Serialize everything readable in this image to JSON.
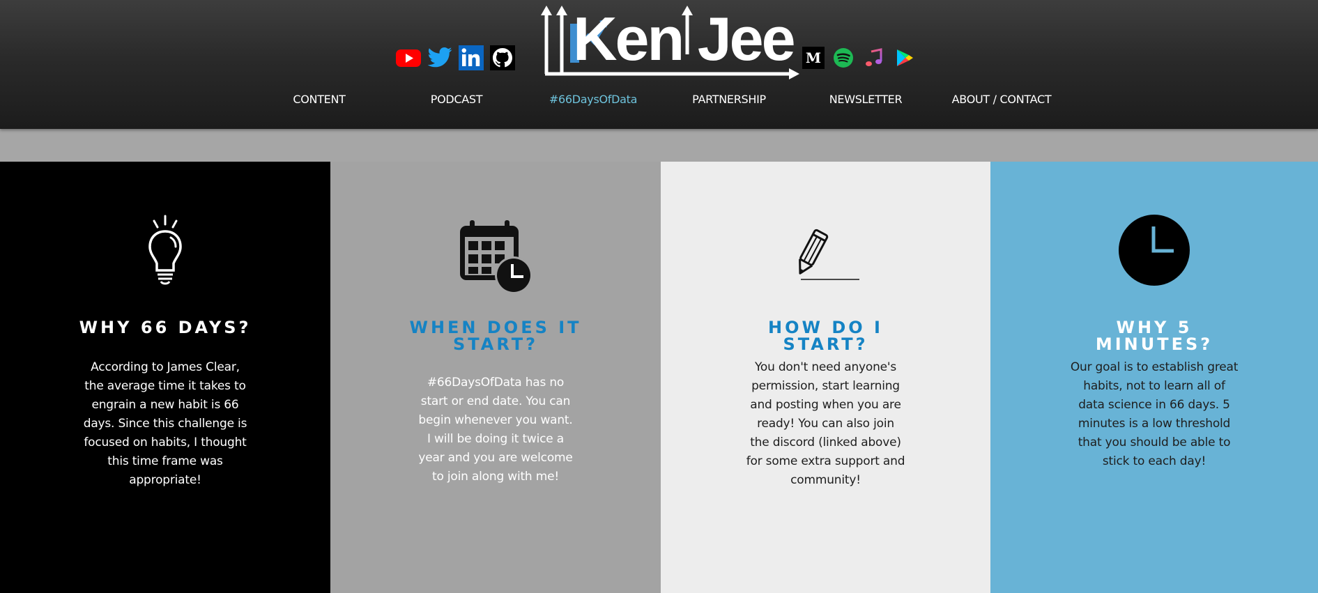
{
  "header": {
    "logo_text": "Ken Jee",
    "social_left": [
      {
        "name": "youtube-icon",
        "color": "#ff0000"
      },
      {
        "name": "twitter-icon",
        "color": "#1da1f2"
      },
      {
        "name": "linkedin-icon",
        "color": "#0a66c2"
      },
      {
        "name": "github-icon",
        "color": "#ffffff"
      }
    ],
    "social_right": [
      {
        "name": "medium-icon",
        "color": "#000000"
      },
      {
        "name": "spotify-icon",
        "color": "#1db954"
      },
      {
        "name": "apple-music-icon",
        "color": "#fc3c44"
      },
      {
        "name": "google-play-icon",
        "color": "#34a853"
      }
    ],
    "nav": [
      {
        "label": "CONTENT",
        "active": false
      },
      {
        "label": "PODCAST",
        "active": false
      },
      {
        "label": "#66DaysOfData",
        "active": true
      },
      {
        "label": "PARTNERSHIP",
        "active": false
      },
      {
        "label": "NEWSLETTER",
        "active": false
      },
      {
        "label": "ABOUT / CONTACT",
        "active": false
      }
    ],
    "active_color": "#6ec3dc"
  },
  "columns": [
    {
      "icon": "lightbulb-icon",
      "title": "WHY 66 DAYS?",
      "body": "According to James Clear, the average time it takes to engrain a new habit is 66 days. Since this challenge is focused on habits, I thought this time frame was appropriate!",
      "background": "#000000"
    },
    {
      "icon": "calendar-clock-icon",
      "title": "WHEN DOES IT START?",
      "body": "#66DaysOfData has no start or end date. You can begin whenever you want. I will be doing it twice a year and you are welcome to join along with me!",
      "background": "#a3a3a3"
    },
    {
      "icon": "pencil-icon",
      "title": "HOW DO I START?",
      "body": "You don't need anyone's permission, start learning and posting when you are ready! You can also join the discord (linked above) for some extra support and community!",
      "background": "#ededed"
    },
    {
      "icon": "clock-icon",
      "title": "WHY 5 MINUTES?",
      "body": "Our goal is to establish great habits, not to learn all of data science in 66 days. 5 minutes is a low threshold that you should be able to stick to each day!",
      "background": "#68b3d6"
    }
  ]
}
